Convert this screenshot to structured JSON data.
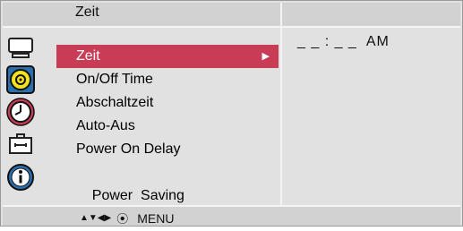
{
  "osd": {
    "title": "Zeit",
    "menu_items": [
      {
        "label": "Zeit",
        "selected": true
      },
      {
        "label": "On/Off Time",
        "selected": false
      },
      {
        "label": "Abschaltzeit",
        "selected": false
      },
      {
        "label": "Auto-Aus",
        "selected": false
      },
      {
        "label": "Power On Delay",
        "selected": false
      },
      {
        "label": "Power  Saving",
        "selected": false
      }
    ],
    "submenu_arrow": "▶",
    "time_value": "_ _ : _ _  AM",
    "nav_arrows": "▲▼◀▶",
    "nav_circle": "⦿",
    "nav_menu_label": "MENU"
  },
  "icons": [
    {
      "name": "picture-icon"
    },
    {
      "name": "sound-icon"
    },
    {
      "name": "clock-icon"
    },
    {
      "name": "option-toolbox-icon"
    },
    {
      "name": "information-icon"
    }
  ],
  "colors": {
    "selected_bg": "#c93c56",
    "panel_bg": "#e1e1e1",
    "bar_bg": "#d2d2d2",
    "icon_blue": "#2a6fb0",
    "sound_yellow": "#f3e21c"
  }
}
